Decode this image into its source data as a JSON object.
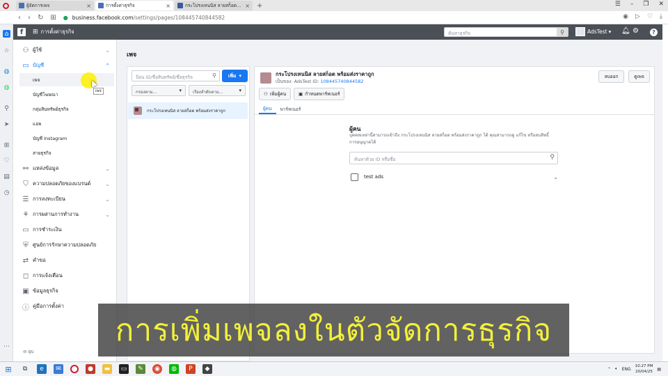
{
  "browser": {
    "tabs": [
      {
        "label": "ผู้จัดการเพจ"
      },
      {
        "label": "การตั้งค่าธุรกิจ"
      },
      {
        "label": "กระโปรงเทนนิส ลายสก็อต พร้อ..."
      }
    ],
    "url_host": "business.facebook.com",
    "url_path": "/settings/pages/108445740844582"
  },
  "header": {
    "title": "การตั้งค่าธุรกิจ",
    "search_placeholder": "ค้นหาธุรกิจ",
    "account_name": "AdsTest"
  },
  "sidebar": {
    "items": [
      {
        "label": "ผู้ใช้"
      },
      {
        "label": "บัญชี"
      },
      {
        "label": "แหล่งข้อมูล"
      },
      {
        "label": "ความปลอดภัยของแบรนด์"
      },
      {
        "label": "การลงทะเบียน"
      },
      {
        "label": "การผสานการทำงาน"
      },
      {
        "label": "การชำระเงิน"
      },
      {
        "label": "ศูนย์การรักษาความปลอดภัย"
      },
      {
        "label": "คำขอ"
      },
      {
        "label": "การแจ้งเตือน"
      },
      {
        "label": "ข้อมูลธุรกิจ"
      },
      {
        "label": "คู่มือการตั้งค่า"
      }
    ],
    "subitems": [
      {
        "label": "เพจ"
      },
      {
        "label": "บัญชีโฆษณา"
      },
      {
        "label": "กลุ่มสินทรัพย์ธุรกิจ"
      },
      {
        "label": "แอพ"
      },
      {
        "label": "บัญชี Instagram"
      },
      {
        "label": "สายธุรกิจ"
      }
    ],
    "collapse_label": "ยุบ",
    "tooltip": "เพจ"
  },
  "main": {
    "page_title": "เพจ",
    "search_placeholder": "ป้อน ID/ชื่อสินทรัพย์/ชื่อธุรกิจ",
    "add_label": "เพิ่ม",
    "filter_label": "กรองตาม...",
    "sort_label": "เรียงลำดับตาม...",
    "list": [
      {
        "name": "กระโปรงเทนนิส ลายสก็อต พร้อมส่งราคาถูก"
      }
    ]
  },
  "detail": {
    "name": "กระโปรงเทนนิส ลายสก็อต พร้อมส่งราคาถูก",
    "owner_prefix": "เป็นของ: AdsTest  ID:",
    "id": "108445740844582",
    "remove_label": "ลบออก",
    "view_label": "ดูเพจ",
    "add_people_label": "เพิ่มผู้คน",
    "assign_partner_label": "กำหนดพาร์ทเนอร์",
    "tabs": [
      {
        "label": "ผู้คน"
      },
      {
        "label": "พาร์ทเนอร์"
      }
    ],
    "people_title": "ผู้คน",
    "people_desc": "บุคคลเหล่านี้สามารถเข้าถึง กระโปรงเทนนิส ลายสก็อต พร้อมส่งราคาถูก ได้ คุณสามารถดู แก้ไข หรือลบสิทธิ์การอนุญาตได้",
    "people_search_placeholder": "ค้นหาด้วย ID หรือชื่อ",
    "people": [
      {
        "name": "test ads"
      }
    ]
  },
  "overlay": {
    "subtitle": "การเพิ่มเพจลงในตัวจัดการธุรกิจ"
  },
  "taskbar": {
    "lang": "ENG",
    "time": "10:27 PM",
    "date": "20/04/25"
  },
  "colors": {
    "accent": "#1877f2",
    "header_bg": "#4b4f56",
    "subtitle_text": "#f2f03a"
  }
}
